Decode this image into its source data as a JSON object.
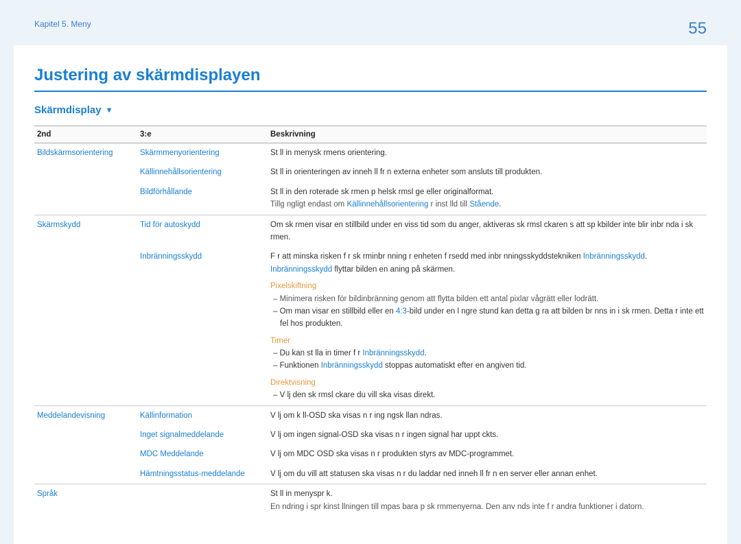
{
  "header": {
    "chapter": "Kapitel 5. Meny",
    "page_number": "55"
  },
  "title": "Justering av skärmdisplayen",
  "subsection": "Skärmdisplay",
  "columns": {
    "c1": "2nd",
    "c2": "3:e",
    "c3": "Beskrivning"
  },
  "rows": {
    "bildskarm": {
      "l2": "Bildskärmsorientering",
      "r1": {
        "l3": "Skärmmenyorientering",
        "desc": "St ll in menysk rmens orientering."
      },
      "r2": {
        "l3": "Källinnehållsorientering",
        "desc": "St ll in orienteringen av inneh ll fr n externa enheter som ansluts till produkten."
      },
      "r3": {
        "l3": "Bildförhållande",
        "desc": "St ll in den roterade sk rmen p  helsk rmsl ge eller originalformat.",
        "note_pre": "Tillg ngligt endast om ",
        "note_blue1": "Källinnehållsorientering",
        "note_mid": "  r inst lld till ",
        "note_blue2": "Stående",
        "note_dot": "."
      }
    },
    "skarmskydd": {
      "l2": "Skärmskydd",
      "r1": {
        "l3": "Tid för autoskydd",
        "desc": "Om sk rmen visar en stillbild under en viss tid som du anger, aktiveras sk rmsl ckaren s  att sp kbilder inte blir inbr nda i sk rmen."
      },
      "r2": {
        "l3": "Inbränningsskydd",
        "desc_pre": "F r att minska risken f r sk rminbr nning  r enheten f rsedd med inbr nningsskyddstekniken ",
        "desc_blue": "Inbränningsskydd",
        "desc_dot": ".",
        "line2_blue": "Inbränningsskydd",
        "line2_rest": " flyttar bilden en aning på skärmen.",
        "pixel_head": "Pixelskiftning",
        "pixel_d1": "Minimera risken för bildinbränning genom att flytta bilden ett antal pixlar vågrätt eller lodrätt.",
        "pixel_d2a": "Om man visar en stillbild eller en ",
        "pixel_d2b": "4:3",
        "pixel_d2c": "-bild under en l ngre stund kan detta g ra att bilden br nns in i sk rmen. Detta  r inte ett fel hos produkten.",
        "timer_head": "Timer",
        "timer_d1a": "Du kan st lla in timer f r ",
        "timer_d1b": "Inbränningsskydd",
        "timer_d1c": ".",
        "timer_d2a": "Funktionen ",
        "timer_d2b": "Inbränningsskydd",
        "timer_d2c": " stoppas automatiskt efter en angiven tid.",
        "direkt_head": "Direktvisning",
        "direkt_d1": "V lj den sk rmsl ckare du vill ska visas direkt."
      }
    },
    "meddelande": {
      "l2": "Meddelandevisning",
      "r1": {
        "l3": "Källinformation",
        "desc": "V lj om k ll-OSD ska visas n r ing ngsk llan  ndras."
      },
      "r2": {
        "l3": "Inget signalmeddelande",
        "desc": "V lj om ingen signal-OSD ska visas n r ingen signal har uppt ckts."
      },
      "r3": {
        "l3": "MDC Meddelande",
        "desc": "V lj om MDC OSD ska visas n r produkten styrs av MDC-programmet."
      },
      "r4": {
        "l3": "Hämtningsstatus-meddelande",
        "desc": "V lj om du vill att statusen ska visas n r du laddar ned inneh ll fr n en server eller annan enhet."
      }
    },
    "sprak": {
      "l2": "Språk",
      "desc": "St ll in menyspr k.",
      "note": "En  ndring i spr kinst llningen till mpas bara p  sk rmmenyerna. Den anv nds inte f r andra funktioner i datorn."
    }
  }
}
